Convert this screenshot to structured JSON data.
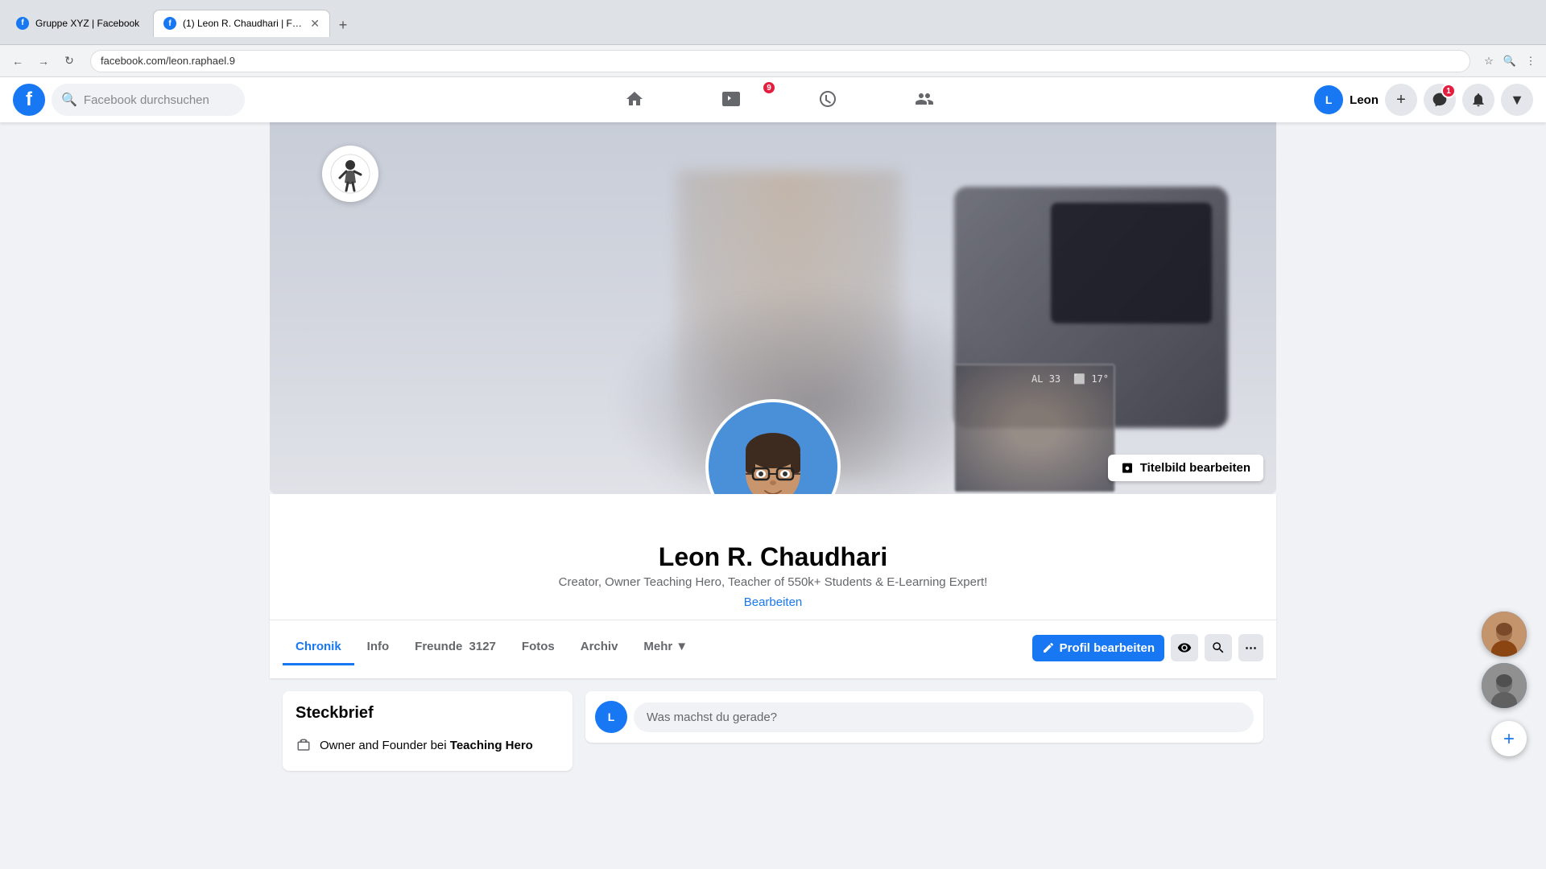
{
  "browser": {
    "tabs": [
      {
        "id": "tab1",
        "title": "Gruppe XYZ | Facebook",
        "favicon": "fb",
        "active": false
      },
      {
        "id": "tab2",
        "title": "(1) Leon R. Chaudhari | Faceb...",
        "favicon": "fb",
        "active": true
      }
    ],
    "address": "facebook.com/leon.raphael.9",
    "new_tab_label": "+"
  },
  "header": {
    "logo": "f",
    "search_placeholder": "Facebook durchsuchen",
    "nav": {
      "home_title": "Startseite",
      "watch_title": "Watch",
      "watch_badge": "9",
      "marketplace_title": "Marketplace",
      "groups_title": "Gruppen"
    },
    "user_name": "Leon",
    "messenger_badge": "1"
  },
  "profile": {
    "name": "Leon R. Chaudhari",
    "bio": "Creator, Owner Teaching Hero, Teacher of 550k+ Students & E-Learning Expert!",
    "edit_link": "Bearbeiten",
    "cover_edit_btn": "Titelbild bearbeiten",
    "tabs": [
      {
        "id": "chronik",
        "label": "Chronik",
        "active": true
      },
      {
        "id": "info",
        "label": "Info",
        "active": false
      },
      {
        "id": "freunde",
        "label": "Freunde",
        "count": "3127",
        "active": false
      },
      {
        "id": "fotos",
        "label": "Fotos",
        "active": false
      },
      {
        "id": "archiv",
        "label": "Archiv",
        "active": false
      },
      {
        "id": "mehr",
        "label": "Mehr",
        "active": false
      }
    ],
    "action_buttons": {
      "edit_profile": "Profil bearbeiten"
    },
    "steckbrief": {
      "title": "Steckbrief",
      "items": [
        {
          "icon": "briefcase",
          "text": "Owner and Founder bei ",
          "bold": "Teaching Hero"
        }
      ]
    }
  },
  "composer": {
    "placeholder": "Was machst du gerade?"
  }
}
